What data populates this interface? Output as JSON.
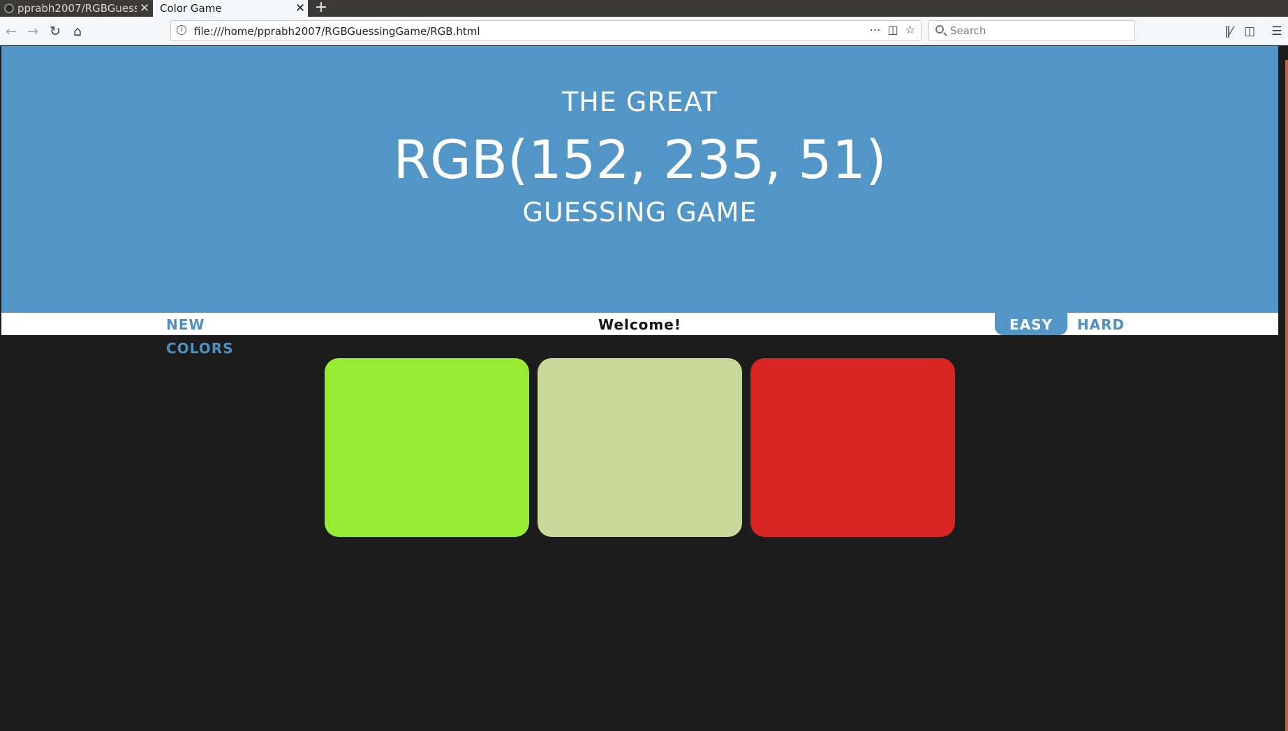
{
  "browser": {
    "tabs": [
      {
        "label": "pprabh2007/RGBGuessi",
        "close": "✕",
        "active": false
      },
      {
        "label": "Color Game",
        "close": "✕",
        "active": true
      }
    ],
    "newtab_label": "+",
    "url": "file:///home/pprabh2007/RGBGuessingGame/RGB.html",
    "search_placeholder": "Search",
    "icons": {
      "back": "back-arrow-icon",
      "forward": "forward-arrow-icon",
      "reload": "reload-icon",
      "home": "home-icon",
      "page_actions": "more-dots-icon",
      "pocket": "pocket-icon",
      "bookmark": "star-icon",
      "library": "library-icon",
      "sidebar": "sidebar-icon",
      "menu": "hamburger-menu-icon"
    }
  },
  "game": {
    "title_line1": "THE GREAT",
    "target_color": "RGB(152, 235, 51)",
    "title_line3": "GUESSING GAME",
    "header_color": "#5296c8",
    "new_colors_label": "NEW COLORS",
    "message": "Welcome!",
    "mode_easy": "EASY",
    "mode_hard": "HARD",
    "selected_mode": "EASY",
    "squares": [
      {
        "color": "#98eb33"
      },
      {
        "color": "#c8d898"
      },
      {
        "color": "#d82521"
      }
    ]
  }
}
